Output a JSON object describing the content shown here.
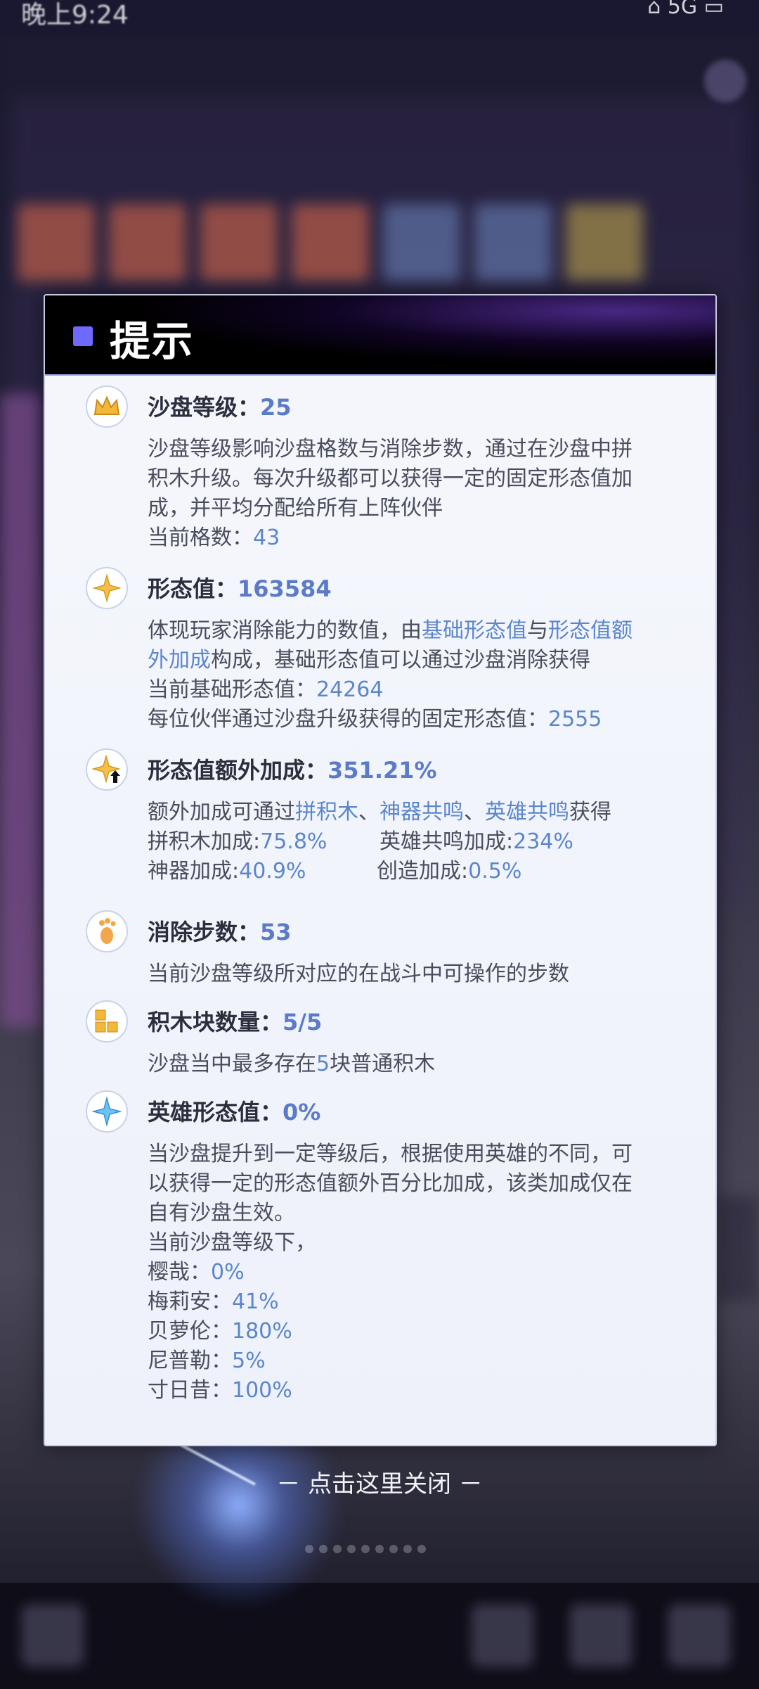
{
  "status_bar": {
    "time": "晚上9:24",
    "icons": "⌂ 5G ▭"
  },
  "dialog": {
    "title": "提示",
    "close_hint": "－ 点击这里关闭 －",
    "sections": {
      "level": {
        "icon": "crown-icon",
        "title": "沙盘等级：",
        "value": "25",
        "desc_lines": [
          "沙盘等级影响沙盘格数与消除步数，通过在沙盘中拼",
          "积木升级。每次升级都可以获得一定的固定形态值加",
          "成，并平均分配给所有上阵伙伴"
        ],
        "grid_label": "当前格数：",
        "grid_value": "43"
      },
      "form": {
        "icon": "star-icon",
        "title": "形态值：",
        "value": "163584",
        "line1_a": "体现玩家消除能力的数值，由",
        "line1_link1": "基础形态值",
        "line1_b": "与",
        "line1_link2a": "形态值额",
        "line2_link2b": "外加成",
        "line2_c": "构成，基础形态值可以通过沙盘消除获得",
        "base_label": "当前基础形态值：",
        "base_value": "24264",
        "fixed_label": "每位伙伴通过沙盘升级获得的固定形态值：",
        "fixed_value": "2555"
      },
      "bonus": {
        "icon": "star-up-icon",
        "title": "形态值额外加成：",
        "value": "351.21%",
        "line_a": "额外加成可通过",
        "link1": "拼积木",
        "sep1": "、",
        "link2": "神器共鸣",
        "sep2": "、",
        "link3": "英雄共鸣",
        "line_b": "获得",
        "block_label": "拼积木加成:",
        "block_value": "75.8%",
        "hero_label": "英雄共鸣加成:",
        "hero_value": "234%",
        "artifact_label": "神器加成:",
        "artifact_value": "40.9%",
        "create_label": "创造加成:",
        "create_value": "0.5%"
      },
      "steps": {
        "icon": "footprint-icon",
        "title": "消除步数：",
        "value": "53",
        "desc": "当前沙盘等级所对应的在战斗中可操作的步数"
      },
      "blocks": {
        "icon": "blocks-icon",
        "title": "积木块数量：",
        "value": "5/5",
        "desc_a": "沙盘当中最多存在",
        "desc_num": "5",
        "desc_b": "块普通积木"
      },
      "hero": {
        "icon": "sparkle-icon",
        "title": "英雄形态值：",
        "value": "0%",
        "desc_lines": [
          "当沙盘提升到一定等级后，根据使用英雄的不同，可",
          "以获得一定的形态值额外百分比加成，该类加成仅在",
          "自有沙盘生效。",
          "当前沙盘等级下，"
        ],
        "heroes": [
          {
            "name": "樱哉：",
            "value": "0%"
          },
          {
            "name": "梅莉安：",
            "value": "41%"
          },
          {
            "name": "贝萝伦：",
            "value": "180%"
          },
          {
            "name": "尼普勒：",
            "value": "5%"
          },
          {
            "name": "寸日昔：",
            "value": "100%"
          }
        ]
      }
    }
  }
}
